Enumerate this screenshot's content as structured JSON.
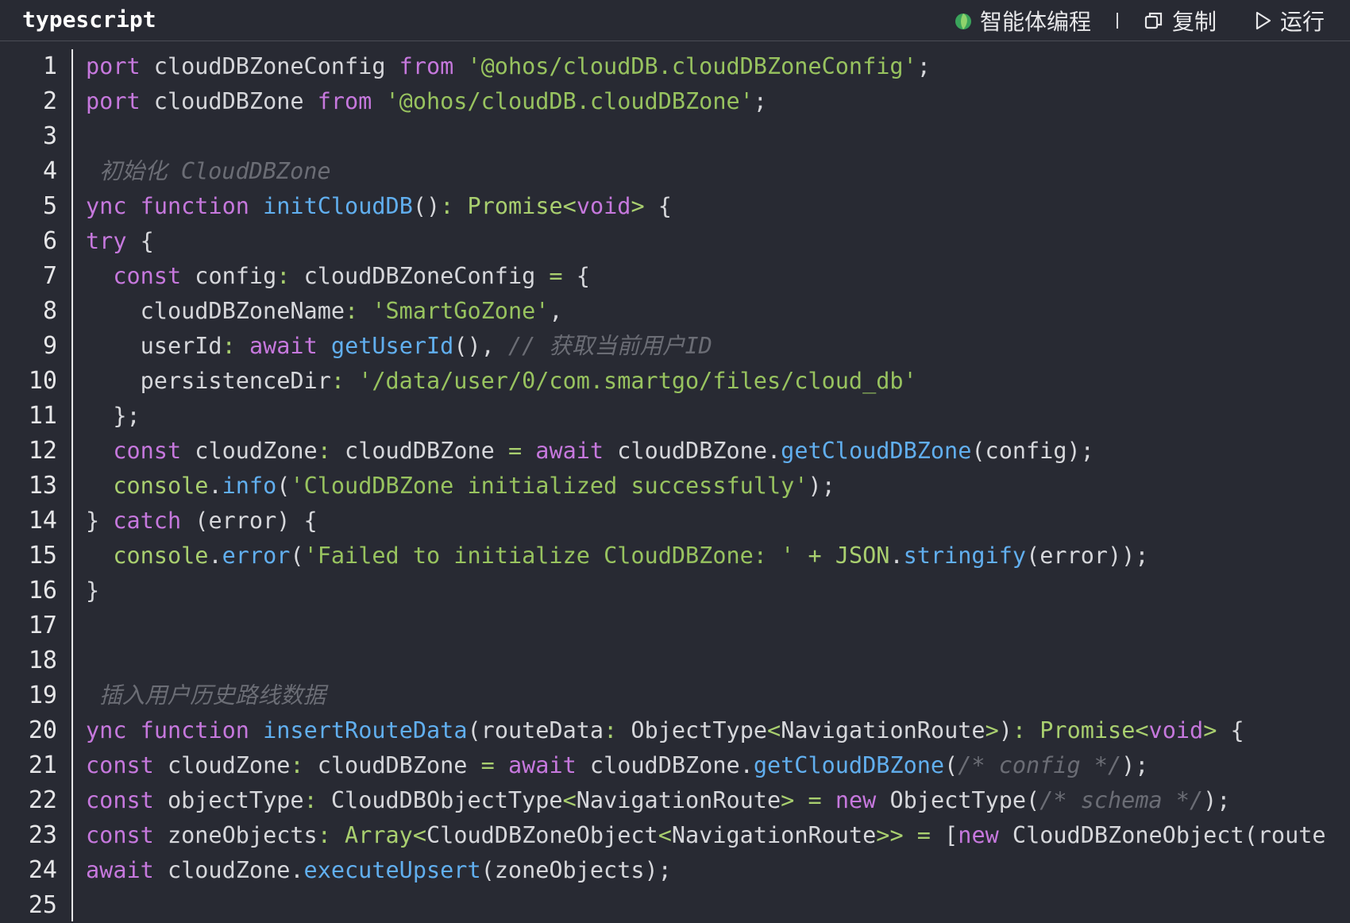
{
  "header": {
    "language": "typescript",
    "agent_label": "智能体编程",
    "copy_label": "复制",
    "run_label": "运行"
  },
  "line_numbers": [
    "1",
    "2",
    "3",
    "4",
    "5",
    "6",
    "7",
    "8",
    "9",
    "10",
    "11",
    "12",
    "13",
    "14",
    "15",
    "16",
    "17",
    "18",
    "19",
    "20",
    "21",
    "22",
    "23",
    "24",
    "25"
  ],
  "code_lines": [
    [
      [
        "kw",
        "port"
      ],
      [
        "pl",
        " cloudDBZoneConfig "
      ],
      [
        "kw",
        "from"
      ],
      [
        "pl",
        " "
      ],
      [
        "str",
        "'@ohos/cloudDB.cloudDBZoneConfig'"
      ],
      [
        "pl",
        ";"
      ]
    ],
    [
      [
        "kw",
        "port"
      ],
      [
        "pl",
        " cloudDBZone "
      ],
      [
        "kw",
        "from"
      ],
      [
        "pl",
        " "
      ],
      [
        "str",
        "'@ohos/cloudDB.cloudDBZone'"
      ],
      [
        "pl",
        ";"
      ]
    ],
    [],
    [
      [
        "cmt",
        " 初始化 CloudDBZone"
      ]
    ],
    [
      [
        "kw",
        "ync"
      ],
      [
        "pl",
        " "
      ],
      [
        "kw",
        "function"
      ],
      [
        "pl",
        " "
      ],
      [
        "fn",
        "initCloudDB"
      ],
      [
        "pl",
        "()"
      ],
      [
        "op",
        ":"
      ],
      [
        "pl",
        " "
      ],
      [
        "typ",
        "Promise"
      ],
      [
        "op",
        "<"
      ],
      [
        "kw",
        "void"
      ],
      [
        "op",
        ">"
      ],
      [
        "pl",
        " {"
      ]
    ],
    [
      [
        "kw",
        "try"
      ],
      [
        "pl",
        " {"
      ]
    ],
    [
      [
        "pl",
        "  "
      ],
      [
        "kw",
        "const"
      ],
      [
        "pl",
        " config"
      ],
      [
        "op",
        ":"
      ],
      [
        "pl",
        " cloudDBZoneConfig "
      ],
      [
        "op",
        "="
      ],
      [
        "pl",
        " {"
      ]
    ],
    [
      [
        "pl",
        "    cloudDBZoneName"
      ],
      [
        "op",
        ":"
      ],
      [
        "pl",
        " "
      ],
      [
        "str",
        "'SmartGoZone'"
      ],
      [
        "pl",
        ","
      ]
    ],
    [
      [
        "pl",
        "    userId"
      ],
      [
        "op",
        ":"
      ],
      [
        "pl",
        " "
      ],
      [
        "kw",
        "await"
      ],
      [
        "pl",
        " "
      ],
      [
        "fn",
        "getUserId"
      ],
      [
        "pl",
        "(), "
      ],
      [
        "cmt",
        "// 获取当前用户ID"
      ]
    ],
    [
      [
        "pl",
        "    persistenceDir"
      ],
      [
        "op",
        ":"
      ],
      [
        "pl",
        " "
      ],
      [
        "str",
        "'/data/user/0/com.smartgo/files/cloud_db'"
      ]
    ],
    [
      [
        "pl",
        "  };"
      ]
    ],
    [
      [
        "pl",
        "  "
      ],
      [
        "kw",
        "const"
      ],
      [
        "pl",
        " cloudZone"
      ],
      [
        "op",
        ":"
      ],
      [
        "pl",
        " cloudDBZone "
      ],
      [
        "op",
        "="
      ],
      [
        "pl",
        " "
      ],
      [
        "kw",
        "await"
      ],
      [
        "pl",
        " cloudDBZone."
      ],
      [
        "fn",
        "getCloudDBZone"
      ],
      [
        "pl",
        "(config);"
      ]
    ],
    [
      [
        "pl",
        "  "
      ],
      [
        "typ",
        "console"
      ],
      [
        "pl",
        "."
      ],
      [
        "fn",
        "info"
      ],
      [
        "pl",
        "("
      ],
      [
        "str",
        "'CloudDBZone initialized successfully'"
      ],
      [
        "pl",
        ");"
      ]
    ],
    [
      [
        "pl",
        "} "
      ],
      [
        "kw",
        "catch"
      ],
      [
        "pl",
        " (error) {"
      ]
    ],
    [
      [
        "pl",
        "  "
      ],
      [
        "typ",
        "console"
      ],
      [
        "pl",
        "."
      ],
      [
        "fn",
        "error"
      ],
      [
        "pl",
        "("
      ],
      [
        "str",
        "'Failed to initialize CloudDBZone: '"
      ],
      [
        "pl",
        " "
      ],
      [
        "op",
        "+"
      ],
      [
        "pl",
        " "
      ],
      [
        "typ",
        "JSON"
      ],
      [
        "pl",
        "."
      ],
      [
        "fn",
        "stringify"
      ],
      [
        "pl",
        "(error));"
      ]
    ],
    [
      [
        "pl",
        "}"
      ]
    ],
    [],
    [],
    [
      [
        "cmt",
        " 插入用户历史路线数据"
      ]
    ],
    [
      [
        "kw",
        "ync"
      ],
      [
        "pl",
        " "
      ],
      [
        "kw",
        "function"
      ],
      [
        "pl",
        " "
      ],
      [
        "fn",
        "insertRouteData"
      ],
      [
        "pl",
        "(routeData"
      ],
      [
        "op",
        ":"
      ],
      [
        "pl",
        " ObjectType"
      ],
      [
        "op",
        "<"
      ],
      [
        "pl",
        "NavigationRoute"
      ],
      [
        "op",
        ">"
      ],
      [
        "pl",
        ")"
      ],
      [
        "op",
        ":"
      ],
      [
        "pl",
        " "
      ],
      [
        "typ",
        "Promise"
      ],
      [
        "op",
        "<"
      ],
      [
        "kw",
        "void"
      ],
      [
        "op",
        ">"
      ],
      [
        "pl",
        " {"
      ]
    ],
    [
      [
        "kw",
        "const"
      ],
      [
        "pl",
        " cloudZone"
      ],
      [
        "op",
        ":"
      ],
      [
        "pl",
        " cloudDBZone "
      ],
      [
        "op",
        "="
      ],
      [
        "pl",
        " "
      ],
      [
        "kw",
        "await"
      ],
      [
        "pl",
        " cloudDBZone."
      ],
      [
        "fn",
        "getCloudDBZone"
      ],
      [
        "pl",
        "("
      ],
      [
        "cmt",
        "/* config */"
      ],
      [
        "pl",
        ");"
      ]
    ],
    [
      [
        "kw",
        "const"
      ],
      [
        "pl",
        " objectType"
      ],
      [
        "op",
        ":"
      ],
      [
        "pl",
        " CloudDBObjectType"
      ],
      [
        "op",
        "<"
      ],
      [
        "pl",
        "NavigationRoute"
      ],
      [
        "op",
        ">"
      ],
      [
        "pl",
        " "
      ],
      [
        "op",
        "="
      ],
      [
        "pl",
        " "
      ],
      [
        "kw",
        "new"
      ],
      [
        "pl",
        " ObjectType("
      ],
      [
        "cmt",
        "/* schema */"
      ],
      [
        "pl",
        ");"
      ]
    ],
    [
      [
        "kw",
        "const"
      ],
      [
        "pl",
        " zoneObjects"
      ],
      [
        "op",
        ":"
      ],
      [
        "pl",
        " "
      ],
      [
        "typ",
        "Array"
      ],
      [
        "op",
        "<"
      ],
      [
        "pl",
        "CloudDBZoneObject"
      ],
      [
        "op",
        "<"
      ],
      [
        "pl",
        "NavigationRoute"
      ],
      [
        "op",
        ">>"
      ],
      [
        "pl",
        " "
      ],
      [
        "op",
        "="
      ],
      [
        "pl",
        " ["
      ],
      [
        "kw",
        "new"
      ],
      [
        "pl",
        " CloudDBZoneObject(routeDa"
      ]
    ],
    [
      [
        "kw",
        "await"
      ],
      [
        "pl",
        " cloudZone."
      ],
      [
        "fn",
        "executeUpsert"
      ],
      [
        "pl",
        "(zoneObjects);"
      ]
    ],
    []
  ]
}
